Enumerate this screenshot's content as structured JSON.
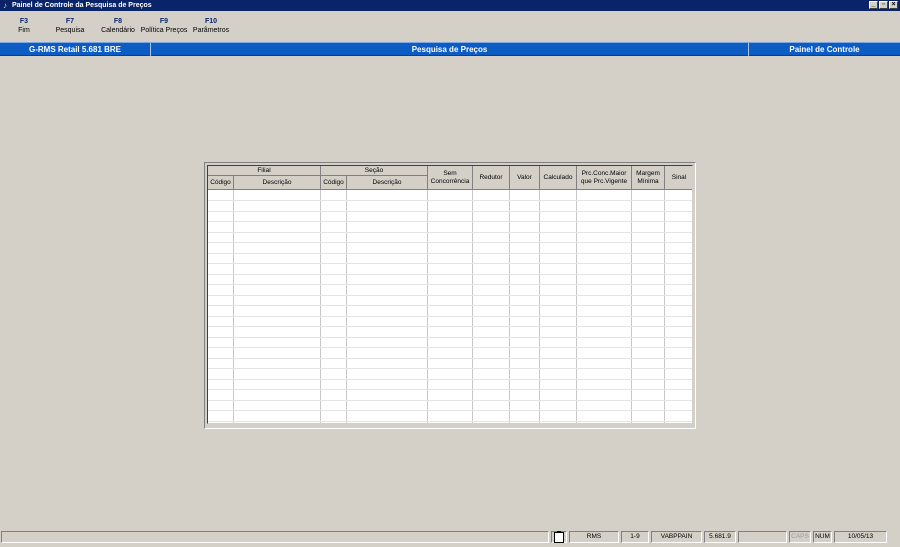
{
  "window": {
    "title": "Painel de Controle da Pesquisa de Preços",
    "buttons": [
      "_",
      "▫",
      "×"
    ]
  },
  "toolbar": {
    "items": [
      {
        "key": "F3",
        "label": "Fim"
      },
      {
        "key": "F7",
        "label": "Pesquisa"
      },
      {
        "key": "F8",
        "label": "Calendário"
      },
      {
        "key": "F9",
        "label": "Política Preços"
      },
      {
        "key": "F10",
        "label": "Parâmetros"
      }
    ]
  },
  "header": {
    "left": "G-RMS Retail 5.681 BRE",
    "center": "Pesquisa de Preços",
    "right": "Painel de Controle",
    "color": "#0c5cc4"
  },
  "grid": {
    "groups": {
      "filial": "Filial",
      "secao": "Seção"
    },
    "columns": {
      "filial_codigo": "Código",
      "filial_descricao": "Descrição",
      "secao_codigo": "Código",
      "secao_descricao": "Descrição",
      "sem_concorrencia_1": "Sem",
      "sem_concorrencia_2": "Concorrência",
      "redutor": "Redutor",
      "valor": "Valor",
      "calculado": "Calculado",
      "prc_conc_1": "Prc.Conc.Maior",
      "prc_conc_2": "que Prc.Vigente",
      "margem_1": "Margem",
      "margem_2": "Mínima",
      "sinal": "Sinal"
    },
    "rows": []
  },
  "statusbar": {
    "system": "RMS",
    "range": "1-9",
    "program": "VABPPAIN",
    "version": "5.681.9",
    "caps": "CAPS",
    "num": "NUM",
    "date": "10/05/13"
  }
}
